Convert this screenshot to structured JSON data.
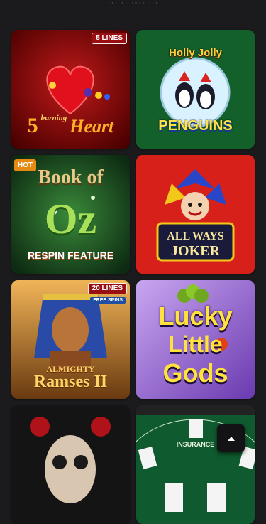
{
  "header": {
    "partial_text": "··· ·· ···· · ·"
  },
  "games": [
    {
      "title_lines": [
        "5",
        "burning",
        "Heart"
      ],
      "badge": "5 LINES"
    },
    {
      "title_lines": [
        "Holly Jolly",
        "PENGUINS"
      ]
    },
    {
      "title_lines": [
        "Book of",
        "Oz",
        "RESPIN FEATURE"
      ],
      "badge": "HOT"
    },
    {
      "title_lines": [
        "ALL WAYS",
        "JOKER"
      ]
    },
    {
      "title_lines": [
        "ALMIGHTY",
        "Ramses II"
      ],
      "badge": "20 LINES",
      "extra_badge": "FREE SPINS"
    },
    {
      "title_lines": [
        "Lucky",
        "Little",
        "Gods"
      ]
    },
    {
      "title_lines": []
    },
    {
      "title_lines": [
        "INSURANCE"
      ]
    }
  ],
  "controls": {
    "scroll_top_icon": "arrow-up-icon"
  }
}
